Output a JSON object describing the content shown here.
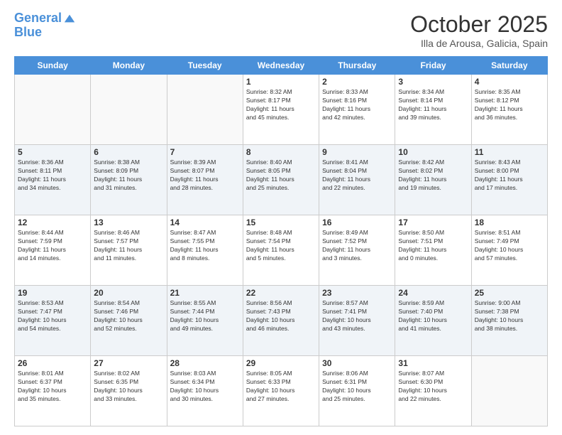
{
  "header": {
    "logo_line1": "General",
    "logo_line2": "Blue",
    "month": "October 2025",
    "location": "Illa de Arousa, Galicia, Spain"
  },
  "days_of_week": [
    "Sunday",
    "Monday",
    "Tuesday",
    "Wednesday",
    "Thursday",
    "Friday",
    "Saturday"
  ],
  "weeks": [
    [
      {
        "day": "",
        "info": ""
      },
      {
        "day": "",
        "info": ""
      },
      {
        "day": "",
        "info": ""
      },
      {
        "day": "1",
        "info": "Sunrise: 8:32 AM\nSunset: 8:17 PM\nDaylight: 11 hours\nand 45 minutes."
      },
      {
        "day": "2",
        "info": "Sunrise: 8:33 AM\nSunset: 8:16 PM\nDaylight: 11 hours\nand 42 minutes."
      },
      {
        "day": "3",
        "info": "Sunrise: 8:34 AM\nSunset: 8:14 PM\nDaylight: 11 hours\nand 39 minutes."
      },
      {
        "day": "4",
        "info": "Sunrise: 8:35 AM\nSunset: 8:12 PM\nDaylight: 11 hours\nand 36 minutes."
      }
    ],
    [
      {
        "day": "5",
        "info": "Sunrise: 8:36 AM\nSunset: 8:11 PM\nDaylight: 11 hours\nand 34 minutes."
      },
      {
        "day": "6",
        "info": "Sunrise: 8:38 AM\nSunset: 8:09 PM\nDaylight: 11 hours\nand 31 minutes."
      },
      {
        "day": "7",
        "info": "Sunrise: 8:39 AM\nSunset: 8:07 PM\nDaylight: 11 hours\nand 28 minutes."
      },
      {
        "day": "8",
        "info": "Sunrise: 8:40 AM\nSunset: 8:05 PM\nDaylight: 11 hours\nand 25 minutes."
      },
      {
        "day": "9",
        "info": "Sunrise: 8:41 AM\nSunset: 8:04 PM\nDaylight: 11 hours\nand 22 minutes."
      },
      {
        "day": "10",
        "info": "Sunrise: 8:42 AM\nSunset: 8:02 PM\nDaylight: 11 hours\nand 19 minutes."
      },
      {
        "day": "11",
        "info": "Sunrise: 8:43 AM\nSunset: 8:00 PM\nDaylight: 11 hours\nand 17 minutes."
      }
    ],
    [
      {
        "day": "12",
        "info": "Sunrise: 8:44 AM\nSunset: 7:59 PM\nDaylight: 11 hours\nand 14 minutes."
      },
      {
        "day": "13",
        "info": "Sunrise: 8:46 AM\nSunset: 7:57 PM\nDaylight: 11 hours\nand 11 minutes."
      },
      {
        "day": "14",
        "info": "Sunrise: 8:47 AM\nSunset: 7:55 PM\nDaylight: 11 hours\nand 8 minutes."
      },
      {
        "day": "15",
        "info": "Sunrise: 8:48 AM\nSunset: 7:54 PM\nDaylight: 11 hours\nand 5 minutes."
      },
      {
        "day": "16",
        "info": "Sunrise: 8:49 AM\nSunset: 7:52 PM\nDaylight: 11 hours\nand 3 minutes."
      },
      {
        "day": "17",
        "info": "Sunrise: 8:50 AM\nSunset: 7:51 PM\nDaylight: 11 hours\nand 0 minutes."
      },
      {
        "day": "18",
        "info": "Sunrise: 8:51 AM\nSunset: 7:49 PM\nDaylight: 10 hours\nand 57 minutes."
      }
    ],
    [
      {
        "day": "19",
        "info": "Sunrise: 8:53 AM\nSunset: 7:47 PM\nDaylight: 10 hours\nand 54 minutes."
      },
      {
        "day": "20",
        "info": "Sunrise: 8:54 AM\nSunset: 7:46 PM\nDaylight: 10 hours\nand 52 minutes."
      },
      {
        "day": "21",
        "info": "Sunrise: 8:55 AM\nSunset: 7:44 PM\nDaylight: 10 hours\nand 49 minutes."
      },
      {
        "day": "22",
        "info": "Sunrise: 8:56 AM\nSunset: 7:43 PM\nDaylight: 10 hours\nand 46 minutes."
      },
      {
        "day": "23",
        "info": "Sunrise: 8:57 AM\nSunset: 7:41 PM\nDaylight: 10 hours\nand 43 minutes."
      },
      {
        "day": "24",
        "info": "Sunrise: 8:59 AM\nSunset: 7:40 PM\nDaylight: 10 hours\nand 41 minutes."
      },
      {
        "day": "25",
        "info": "Sunrise: 9:00 AM\nSunset: 7:38 PM\nDaylight: 10 hours\nand 38 minutes."
      }
    ],
    [
      {
        "day": "26",
        "info": "Sunrise: 8:01 AM\nSunset: 6:37 PM\nDaylight: 10 hours\nand 35 minutes."
      },
      {
        "day": "27",
        "info": "Sunrise: 8:02 AM\nSunset: 6:35 PM\nDaylight: 10 hours\nand 33 minutes."
      },
      {
        "day": "28",
        "info": "Sunrise: 8:03 AM\nSunset: 6:34 PM\nDaylight: 10 hours\nand 30 minutes."
      },
      {
        "day": "29",
        "info": "Sunrise: 8:05 AM\nSunset: 6:33 PM\nDaylight: 10 hours\nand 27 minutes."
      },
      {
        "day": "30",
        "info": "Sunrise: 8:06 AM\nSunset: 6:31 PM\nDaylight: 10 hours\nand 25 minutes."
      },
      {
        "day": "31",
        "info": "Sunrise: 8:07 AM\nSunset: 6:30 PM\nDaylight: 10 hours\nand 22 minutes."
      },
      {
        "day": "",
        "info": ""
      }
    ]
  ]
}
